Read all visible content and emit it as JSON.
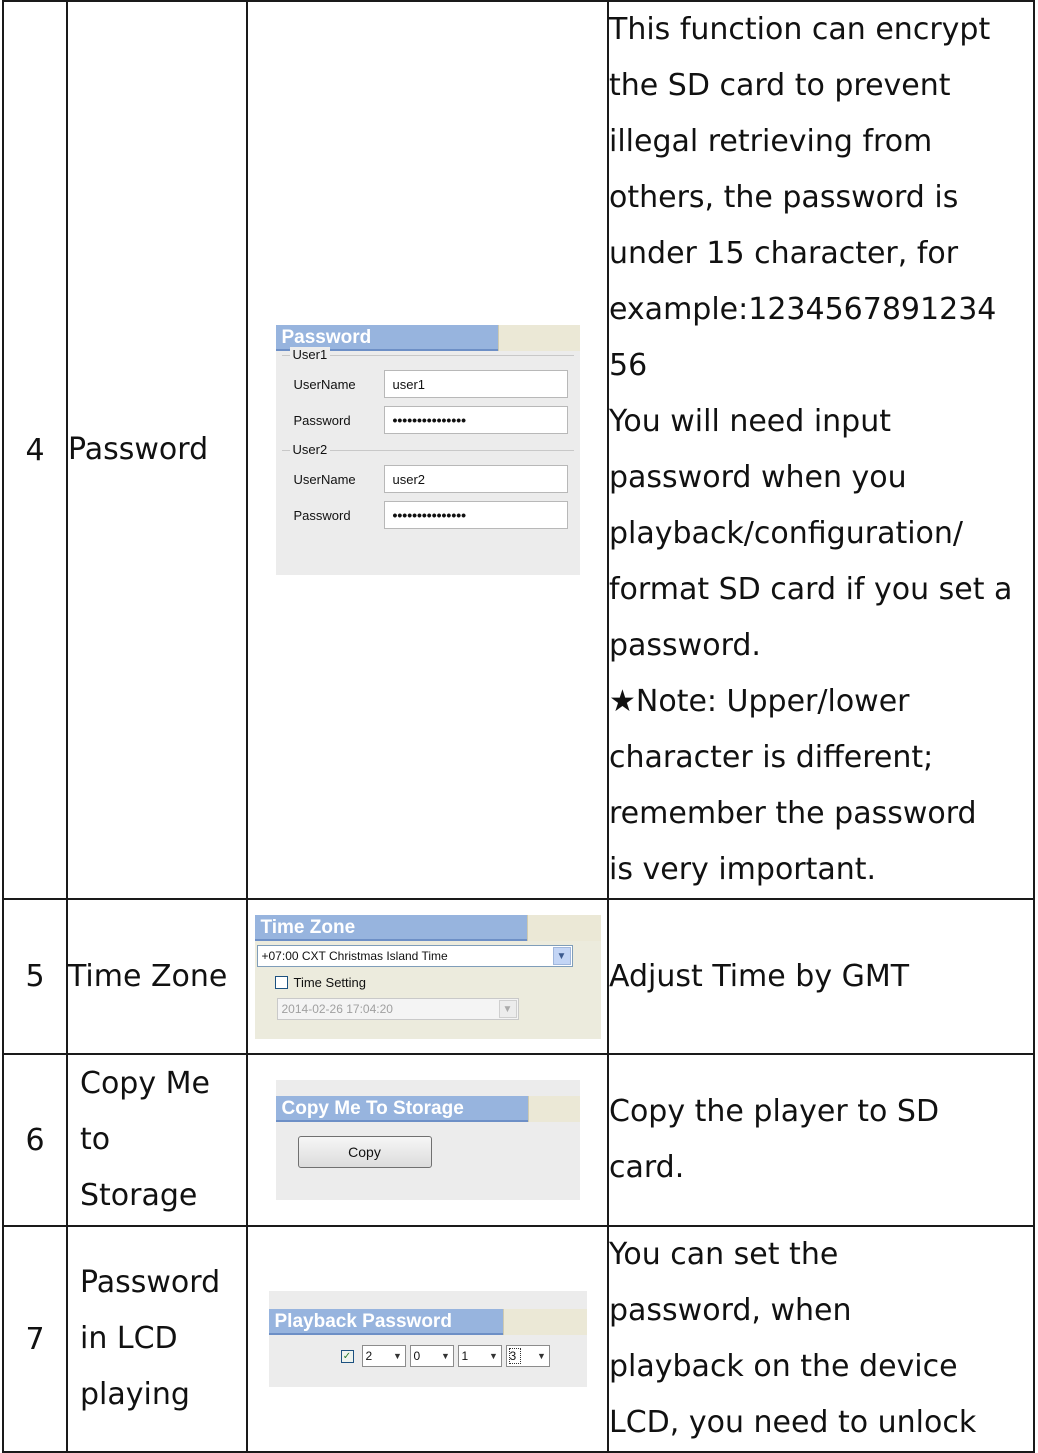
{
  "rows": [
    {
      "num": "4",
      "name": "Password",
      "desc_lines": [
        "This function can encrypt",
        "the SD card to prevent",
        "illegal retrieving from",
        "others, the password is",
        "under 15 character, for",
        "example:1234567891234",
        "56",
        "You will need input",
        "password when you",
        "playback/configuration/",
        "format SD card if you set a",
        "password.",
        "★Note: Upper/lower",
        "character is different;",
        "remember the password",
        "is very important."
      ],
      "panel": {
        "header": "Password",
        "user1": {
          "group": "User1",
          "username_label": "UserName",
          "username_value": "user1",
          "password_label": "Password",
          "password_value": "•••••••••••••••"
        },
        "user2": {
          "group": "User2",
          "username_label": "UserName",
          "username_value": "user2",
          "password_label": "Password",
          "password_value": "•••••••••••••••"
        }
      }
    },
    {
      "num": "5",
      "name": "Time Zone",
      "desc_lines": [
        "Adjust Time by GMT"
      ],
      "panel": {
        "header": "Time Zone",
        "timezone_value": "+07:00 CXT Christmas Island Time",
        "time_setting_label": "Time Setting",
        "datetime_value": "2014-02-26 17:04:20"
      }
    },
    {
      "num": "6",
      "name_lines": [
        "Copy Me",
        "to",
        "Storage"
      ],
      "desc_lines": [
        "Copy the player to SD",
        "card."
      ],
      "panel": {
        "header": "Copy Me To Storage",
        "button_label": "Copy"
      }
    },
    {
      "num": "7",
      "name_lines": [
        "Password",
        "in LCD",
        "playing"
      ],
      "desc_lines": [
        "You can set the",
        "password, when",
        "playback on the device",
        "LCD, you need to unlock"
      ],
      "panel": {
        "header": "Playback Password",
        "digits": [
          "2",
          "0",
          "1",
          "3"
        ]
      }
    }
  ]
}
